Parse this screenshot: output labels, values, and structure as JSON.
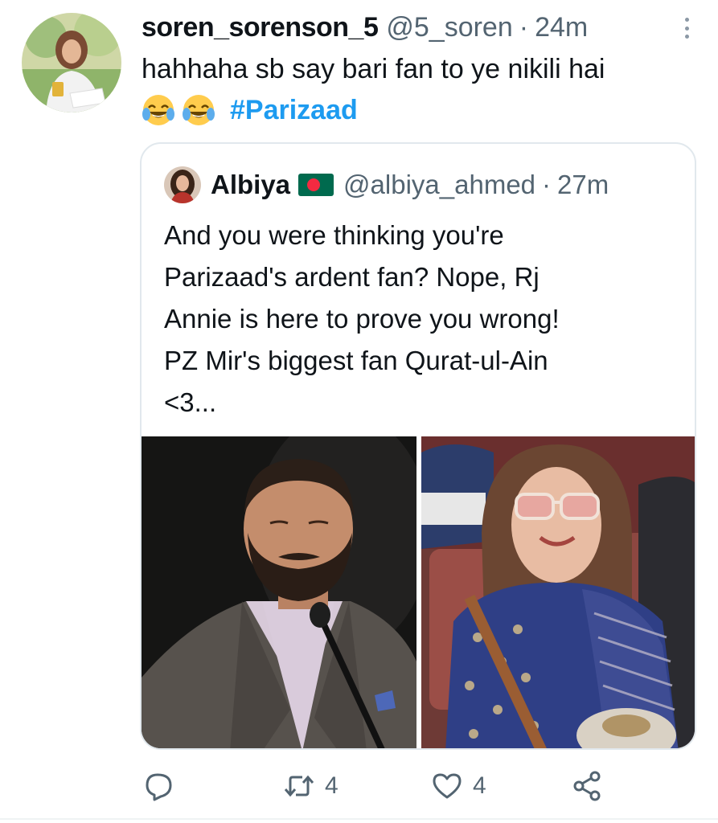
{
  "tweet": {
    "display_name": "soren_sorenson_5",
    "handle": "@5_soren",
    "separator": "·",
    "time": "24m",
    "text_line1": "hahhaha sb say bari fan to ye nikili hai",
    "emojis": [
      "face-with-tears-of-joy",
      "face-with-tears-of-joy"
    ],
    "hashtag": "#Parizaad"
  },
  "quoted_tweet": {
    "display_name": "Albiya",
    "flag": "bangladesh-flag",
    "handle": "@albiya_ahmed",
    "separator": "·",
    "time": "27m",
    "text_lines": [
      "And you were thinking you're",
      "Parizaad's ardent fan? Nope, Rj",
      "Annie is here to prove you wrong!",
      "PZ Mir's biggest fan Qurat-ul-Ain",
      "<3..."
    ],
    "media": [
      "photo-man-bearded-at-microphone",
      "photo-woman-sunglasses-in-audience"
    ]
  },
  "actions": {
    "reply_count": "",
    "retweet_count": "4",
    "like_count": "4",
    "share_count": ""
  },
  "colors": {
    "link": "#1d9bf0",
    "secondary_text": "#536471",
    "border": "#e1e8ed"
  }
}
